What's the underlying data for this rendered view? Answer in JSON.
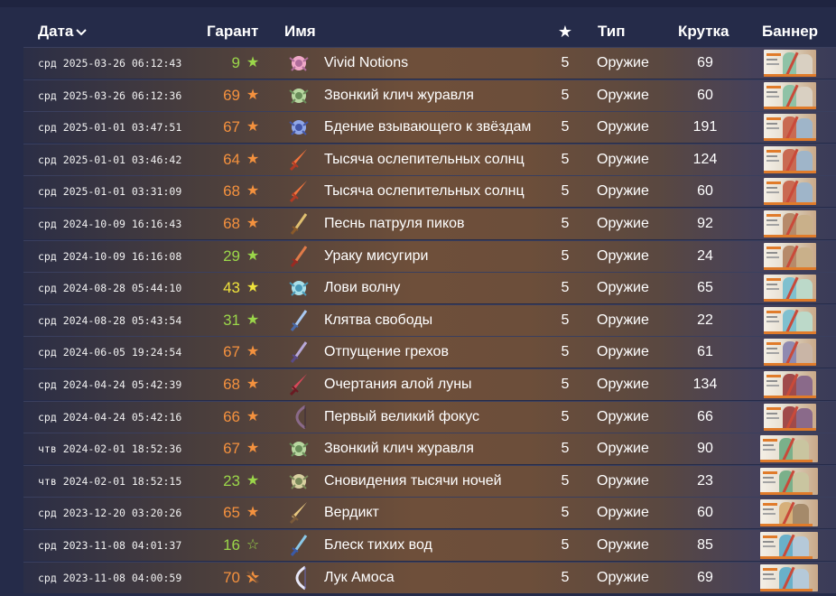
{
  "header": {
    "date": "Дата",
    "garant": "Гарант",
    "name": "Имя",
    "star": "★",
    "type": "Тип",
    "krutka": "Крутка",
    "banner": "Баннер"
  },
  "colors": {
    "orange": "#f4913e",
    "green": "#9bd64a",
    "yellow": "#efe23c",
    "background": "#252b49"
  },
  "rows": [
    {
      "date": "срд 2025-03-26 06:12:43",
      "garant": "9",
      "garant_color": "green",
      "garant_icon": "★",
      "name": "Vivid Notions",
      "rarity": "5",
      "type": "Оружие",
      "krutka": "69",
      "icon": "catalyst-icon-pink",
      "banner": "banner-thumbnail-a"
    },
    {
      "date": "срд 2025-03-26 06:12:36",
      "garant": "69",
      "garant_color": "orange",
      "garant_icon": "★",
      "name": "Звонкий клич журавля",
      "rarity": "5",
      "type": "Оружие",
      "krutka": "60",
      "icon": "catalyst-icon-green",
      "banner": "banner-thumbnail-a"
    },
    {
      "date": "срд 2025-01-01 03:47:51",
      "garant": "67",
      "garant_color": "orange",
      "garant_icon": "★",
      "name": "Бдение взывающего к звёздам",
      "rarity": "5",
      "type": "Оружие",
      "krutka": "191",
      "icon": "catalyst-icon-blue",
      "banner": "banner-thumbnail-b"
    },
    {
      "date": "срд 2025-01-01 03:46:42",
      "garant": "64",
      "garant_color": "orange",
      "garant_icon": "★",
      "name": "Тысяча ослепительных солнц",
      "rarity": "5",
      "type": "Оружие",
      "krutka": "124",
      "icon": "claymore-icon-red",
      "banner": "banner-thumbnail-b"
    },
    {
      "date": "срд 2025-01-01 03:31:09",
      "garant": "68",
      "garant_color": "orange",
      "garant_icon": "★",
      "name": "Тысяча ослепительных солнц",
      "rarity": "5",
      "type": "Оружие",
      "krutka": "60",
      "icon": "claymore-icon-red",
      "banner": "banner-thumbnail-b"
    },
    {
      "date": "срд 2024-10-09 16:16:43",
      "garant": "68",
      "garant_color": "orange",
      "garant_icon": "★",
      "name": "Песнь патруля пиков",
      "rarity": "5",
      "type": "Оружие",
      "krutka": "92",
      "icon": "sword-icon-gold",
      "banner": "banner-thumbnail-c"
    },
    {
      "date": "срд 2024-10-09 16:16:08",
      "garant": "29",
      "garant_color": "green",
      "garant_icon": "★",
      "name": "Ураку мисугири",
      "rarity": "5",
      "type": "Оружие",
      "krutka": "24",
      "icon": "sword-icon-red",
      "banner": "banner-thumbnail-c"
    },
    {
      "date": "срд 2024-08-28 05:44:10",
      "garant": "43",
      "garant_color": "yellow",
      "garant_icon": "★",
      "name": "Лови волну",
      "rarity": "5",
      "type": "Оружие",
      "krutka": "65",
      "icon": "catalyst-icon-cyan",
      "banner": "banner-thumbnail-d"
    },
    {
      "date": "срд 2024-08-28 05:43:54",
      "garant": "31",
      "garant_color": "green",
      "garant_icon": "★",
      "name": "Клятва свободы",
      "rarity": "5",
      "type": "Оружие",
      "krutka": "22",
      "icon": "sword-icon-blue",
      "banner": "banner-thumbnail-d"
    },
    {
      "date": "срд 2024-06-05 19:24:54",
      "garant": "67",
      "garant_color": "orange",
      "garant_icon": "★",
      "name": "Отпущение грехов",
      "rarity": "5",
      "type": "Оружие",
      "krutka": "61",
      "icon": "sword-icon-purple",
      "banner": "banner-thumbnail-e"
    },
    {
      "date": "срд 2024-04-24 05:42:39",
      "garant": "68",
      "garant_color": "orange",
      "garant_icon": "★",
      "name": "Очертания алой луны",
      "rarity": "5",
      "type": "Оружие",
      "krutka": "134",
      "icon": "claymore-icon-crimson",
      "banner": "banner-thumbnail-f"
    },
    {
      "date": "срд 2024-04-24 05:42:16",
      "garant": "66",
      "garant_color": "orange",
      "garant_icon": "★",
      "name": "Первый великий фокус",
      "rarity": "5",
      "type": "Оружие",
      "krutka": "66",
      "icon": "bow-icon-dark",
      "banner": "banner-thumbnail-f"
    },
    {
      "date": "чтв 2024-02-01 18:52:36",
      "garant": "67",
      "garant_color": "orange",
      "garant_icon": "★",
      "name": "Звонкий клич журавля",
      "rarity": "5",
      "type": "Оружие",
      "krutka": "90",
      "icon": "catalyst-icon-green",
      "banner": "banner-thumbnail-g"
    },
    {
      "date": "чтв 2024-02-01 18:52:15",
      "garant": "23",
      "garant_color": "green",
      "garant_icon": "★",
      "name": "Сновидения тысячи ночей",
      "rarity": "5",
      "type": "Оружие",
      "krutka": "23",
      "icon": "catalyst-icon-lamp",
      "banner": "banner-thumbnail-g"
    },
    {
      "date": "срд 2023-12-20 03:20:26",
      "garant": "65",
      "garant_color": "orange",
      "garant_icon": "★",
      "name": "Вердикт",
      "rarity": "5",
      "type": "Оружие",
      "krutka": "60",
      "icon": "claymore-icon-gold",
      "banner": "banner-thumbnail-h"
    },
    {
      "date": "срд 2023-11-08 04:01:37",
      "garant": "16",
      "garant_color": "green",
      "garant_icon": "☆",
      "name": "Блеск тихих вод",
      "rarity": "5",
      "type": "Оружие",
      "krutka": "85",
      "icon": "sword-icon-teal",
      "banner": "banner-thumbnail-i"
    },
    {
      "date": "срд 2023-11-08 04:00:59",
      "garant": "70",
      "garant_color": "orange",
      "garant_icon": "crossed-star",
      "name": "Лук Амоса",
      "rarity": "5",
      "type": "Оружие",
      "krutka": "69",
      "icon": "bow-icon-white",
      "banner": "banner-thumbnail-i"
    }
  ]
}
